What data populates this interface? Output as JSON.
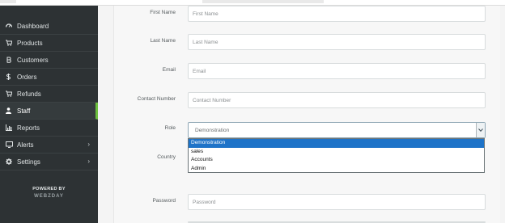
{
  "sidebar": {
    "items": [
      {
        "label": "Dashboard",
        "icon": "dashboard-icon",
        "active": false
      },
      {
        "label": "Products",
        "icon": "cart-icon",
        "active": false
      },
      {
        "label": "Customers",
        "icon": "currency-icon",
        "active": false
      },
      {
        "label": "Orders",
        "icon": "dollar-icon",
        "active": false
      },
      {
        "label": "Refunds",
        "icon": "refund-icon",
        "active": false
      },
      {
        "label": "Staff",
        "icon": "user-icon",
        "active": true
      },
      {
        "label": "Reports",
        "icon": "bar-chart-icon",
        "active": false
      },
      {
        "label": "Alerts",
        "icon": "monitor-icon",
        "active": false,
        "chevron": "›"
      },
      {
        "label": "Settings",
        "icon": "gear-icon",
        "active": false,
        "chevron": "›"
      }
    ],
    "powered_by": "POWERED BY",
    "brand": "WEBZDAY"
  },
  "form": {
    "first_name": {
      "label": "First Name",
      "placeholder": "First Name"
    },
    "last_name": {
      "label": "Last Name",
      "placeholder": "Last Name"
    },
    "email": {
      "label": "Email",
      "placeholder": "Email"
    },
    "contact": {
      "label": "Contact Number",
      "placeholder": "Contact Number"
    },
    "role": {
      "label": "Role",
      "selected": "Demonstration",
      "options": [
        "Demonstration",
        "sales",
        "Accounts",
        "Admin"
      ],
      "highlighted_option": "Demonstration"
    },
    "country": {
      "label": "Country"
    },
    "password": {
      "label": "Password",
      "placeholder": "Password"
    }
  },
  "colors": {
    "sidebar_bg": "#2d3234",
    "active_accent": "#6cbf3e",
    "highlight": "#1e73c8"
  }
}
